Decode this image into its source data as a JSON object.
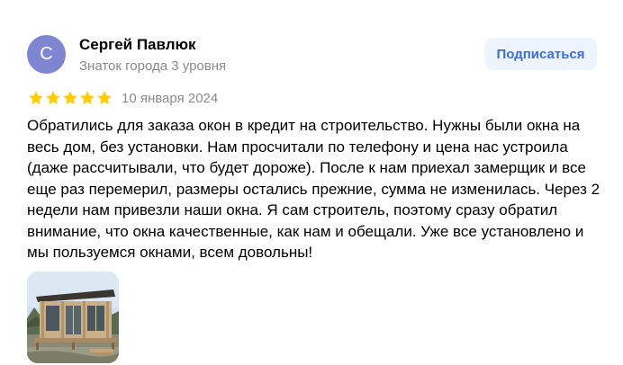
{
  "author": {
    "avatar_letter": "С",
    "name": "Сергей Павлюк",
    "level": "Знаток города 3 уровня"
  },
  "subscribe": {
    "label": "Подписаться"
  },
  "review": {
    "rating": 5,
    "rating_max": 5,
    "date": "10 января 2024",
    "text": "Обратились для заказа окон в кредит на строительство. Нужны были окна на весь дом, без установки. Нам просчитали по телефону и цена нас устроила (даже рассчитывали, что будет дороже). После к нам приехал замерщик и все еще раз перемерил, размеры остались прежние, сумма не изменилась. Через 2 недели нам привезли наши окна. Я сам строитель, поэтому сразу обратил внимание, что окна качественные, как нам и обещали. Уже все установлено и мы пользуемся окнами, всем довольны!"
  },
  "colors": {
    "avatar_bg": "#7f86d1",
    "star": "#ffcc00",
    "accent": "#3b6fd4",
    "button_bg": "#eef4fd",
    "muted_text": "#8a8a8a"
  },
  "icons": {
    "star": "star-icon",
    "photo": "house-photo"
  }
}
